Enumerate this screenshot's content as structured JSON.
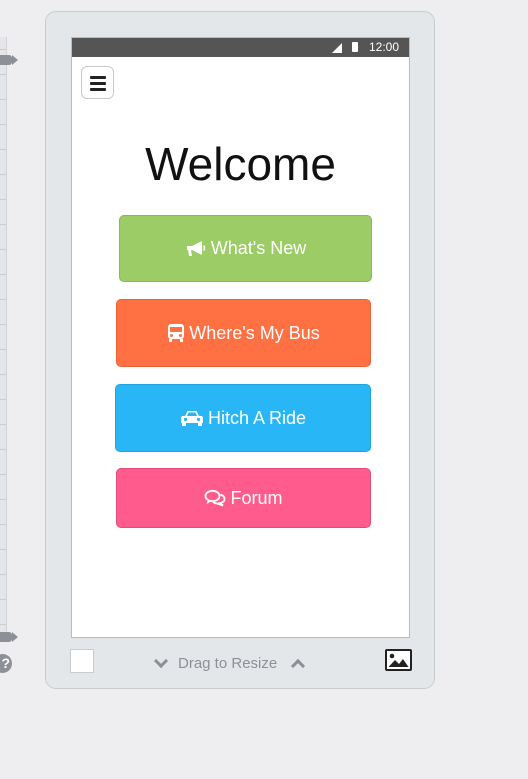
{
  "status_bar": {
    "time": "12:00",
    "icons": [
      "signal-icon",
      "battery-icon"
    ]
  },
  "menu": {
    "icon": "hamburger-menu-icon"
  },
  "page": {
    "title": "Welcome"
  },
  "buttons": [
    {
      "label": "What's New",
      "icon": "megaphone-icon",
      "color": "#9ccc65"
    },
    {
      "label": "Where's My Bus",
      "icon": "bus-icon",
      "color": "#ff7043"
    },
    {
      "label": "Hitch A Ride",
      "icon": "car-icon",
      "color": "#29b6f6"
    },
    {
      "label": "Forum",
      "icon": "comments-icon",
      "color": "#ff5c8d"
    }
  ],
  "bottom_bar": {
    "resize_label": "Drag to Resize",
    "icons": [
      "chevron-down-icon",
      "chevron-up-icon",
      "image-icon"
    ]
  },
  "help_badge": "?"
}
